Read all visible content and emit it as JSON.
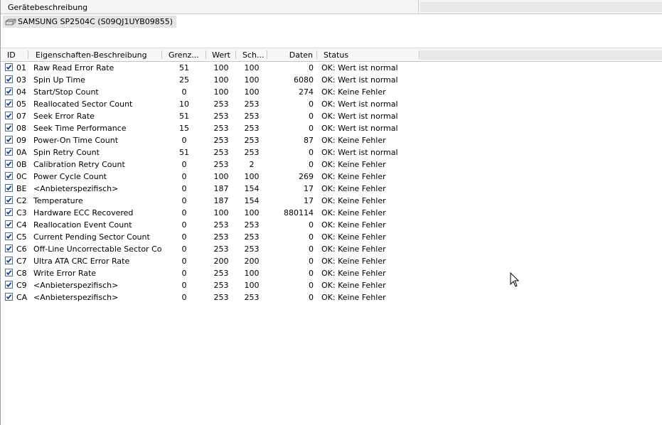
{
  "device_list": {
    "header": "Gerätebeschreibung",
    "devices": [
      {
        "label": "SAMSUNG SP2504C (S09QJ1UYB09855)",
        "icon": "hard-disk-icon"
      }
    ]
  },
  "table": {
    "columns": {
      "id": "ID",
      "desc": "Eigenschaften-Beschreibung",
      "threshold": "Grenz...",
      "value": "Wert",
      "worst": "Sch...",
      "data": "Daten",
      "status": "Status"
    },
    "rows": [
      {
        "checked": true,
        "id": "01",
        "desc": "Raw Read Error Rate",
        "threshold": "51",
        "value": "100",
        "worst": "100",
        "data": "0",
        "status": "OK: Wert ist normal"
      },
      {
        "checked": true,
        "id": "03",
        "desc": "Spin Up Time",
        "threshold": "25",
        "value": "100",
        "worst": "100",
        "data": "6080",
        "status": "OK: Wert ist normal"
      },
      {
        "checked": true,
        "id": "04",
        "desc": "Start/Stop Count",
        "threshold": "0",
        "value": "100",
        "worst": "100",
        "data": "274",
        "status": "OK: Keine Fehler"
      },
      {
        "checked": true,
        "id": "05",
        "desc": "Reallocated Sector Count",
        "threshold": "10",
        "value": "253",
        "worst": "253",
        "data": "0",
        "status": "OK: Wert ist normal"
      },
      {
        "checked": true,
        "id": "07",
        "desc": "Seek Error Rate",
        "threshold": "51",
        "value": "253",
        "worst": "253",
        "data": "0",
        "status": "OK: Wert ist normal"
      },
      {
        "checked": true,
        "id": "08",
        "desc": "Seek Time Performance",
        "threshold": "15",
        "value": "253",
        "worst": "253",
        "data": "0",
        "status": "OK: Wert ist normal"
      },
      {
        "checked": true,
        "id": "09",
        "desc": "Power-On Time Count",
        "threshold": "0",
        "value": "253",
        "worst": "253",
        "data": "87",
        "status": "OK: Keine Fehler"
      },
      {
        "checked": true,
        "id": "0A",
        "desc": "Spin Retry Count",
        "threshold": "51",
        "value": "253",
        "worst": "253",
        "data": "0",
        "status": "OK: Wert ist normal"
      },
      {
        "checked": true,
        "id": "0B",
        "desc": "Calibration Retry Count",
        "threshold": "0",
        "value": "253",
        "worst": "2",
        "data": "0",
        "status": "OK: Keine Fehler"
      },
      {
        "checked": true,
        "id": "0C",
        "desc": "Power Cycle Count",
        "threshold": "0",
        "value": "100",
        "worst": "100",
        "data": "269",
        "status": "OK: Keine Fehler"
      },
      {
        "checked": true,
        "id": "BE",
        "desc": "<Anbieterspezifisch>",
        "threshold": "0",
        "value": "187",
        "worst": "154",
        "data": "17",
        "status": "OK: Keine Fehler"
      },
      {
        "checked": true,
        "id": "C2",
        "desc": "Temperature",
        "threshold": "0",
        "value": "187",
        "worst": "154",
        "data": "17",
        "status": "OK: Keine Fehler"
      },
      {
        "checked": true,
        "id": "C3",
        "desc": "Hardware ECC Recovered",
        "threshold": "0",
        "value": "100",
        "worst": "100",
        "data": "880114",
        "status": "OK: Keine Fehler"
      },
      {
        "checked": true,
        "id": "C4",
        "desc": "Reallocation Event Count",
        "threshold": "0",
        "value": "253",
        "worst": "253",
        "data": "0",
        "status": "OK: Keine Fehler"
      },
      {
        "checked": true,
        "id": "C5",
        "desc": "Current Pending Sector Count",
        "threshold": "0",
        "value": "253",
        "worst": "253",
        "data": "0",
        "status": "OK: Keine Fehler"
      },
      {
        "checked": true,
        "id": "C6",
        "desc": "Off-Line Uncorrectable Sector Count",
        "threshold": "0",
        "value": "253",
        "worst": "253",
        "data": "0",
        "status": "OK: Keine Fehler"
      },
      {
        "checked": true,
        "id": "C7",
        "desc": "Ultra ATA CRC Error Rate",
        "threshold": "0",
        "value": "200",
        "worst": "200",
        "data": "0",
        "status": "OK: Keine Fehler"
      },
      {
        "checked": true,
        "id": "C8",
        "desc": "Write Error Rate",
        "threshold": "0",
        "value": "253",
        "worst": "100",
        "data": "0",
        "status": "OK: Keine Fehler"
      },
      {
        "checked": true,
        "id": "C9",
        "desc": "<Anbieterspezifisch>",
        "threshold": "0",
        "value": "253",
        "worst": "100",
        "data": "0",
        "status": "OK: Keine Fehler"
      },
      {
        "checked": true,
        "id": "CA",
        "desc": "<Anbieterspezifisch>",
        "threshold": "0",
        "value": "253",
        "worst": "253",
        "data": "0",
        "status": "OK: Keine Fehler"
      }
    ]
  },
  "colors": {
    "checkbox_check": "#1a3f8f",
    "selection": "#e6e6e6",
    "header_bg": "#f7f7f7"
  },
  "cursor_icon": "mouse-pointer-icon"
}
